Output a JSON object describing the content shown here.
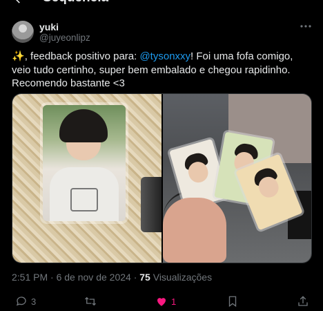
{
  "header": {
    "title": "Sequência"
  },
  "author": {
    "display_name": "yuki",
    "handle": "@juyeonlipz"
  },
  "tweet": {
    "sparkle": "✨",
    "text_before": ", feedback positivo para: ",
    "mention": "@tysonxxy",
    "text_after": "! Foi uma fofa comigo, veio tudo certinho, super bem embalado e chegou rapidinho. Recomendo bastante <3"
  },
  "meta": {
    "time": "2:51 PM",
    "sep1": " · ",
    "date": "6 de nov de 2024",
    "sep2": " · ",
    "views_count": "75",
    "views_label": " Visualizações"
  },
  "actions": {
    "replies": "3",
    "retweets": "",
    "likes": "1",
    "like_color": "#f91880"
  },
  "colors": {
    "accent": "#1d9bf0",
    "muted": "#71767b",
    "background": "#000000"
  }
}
